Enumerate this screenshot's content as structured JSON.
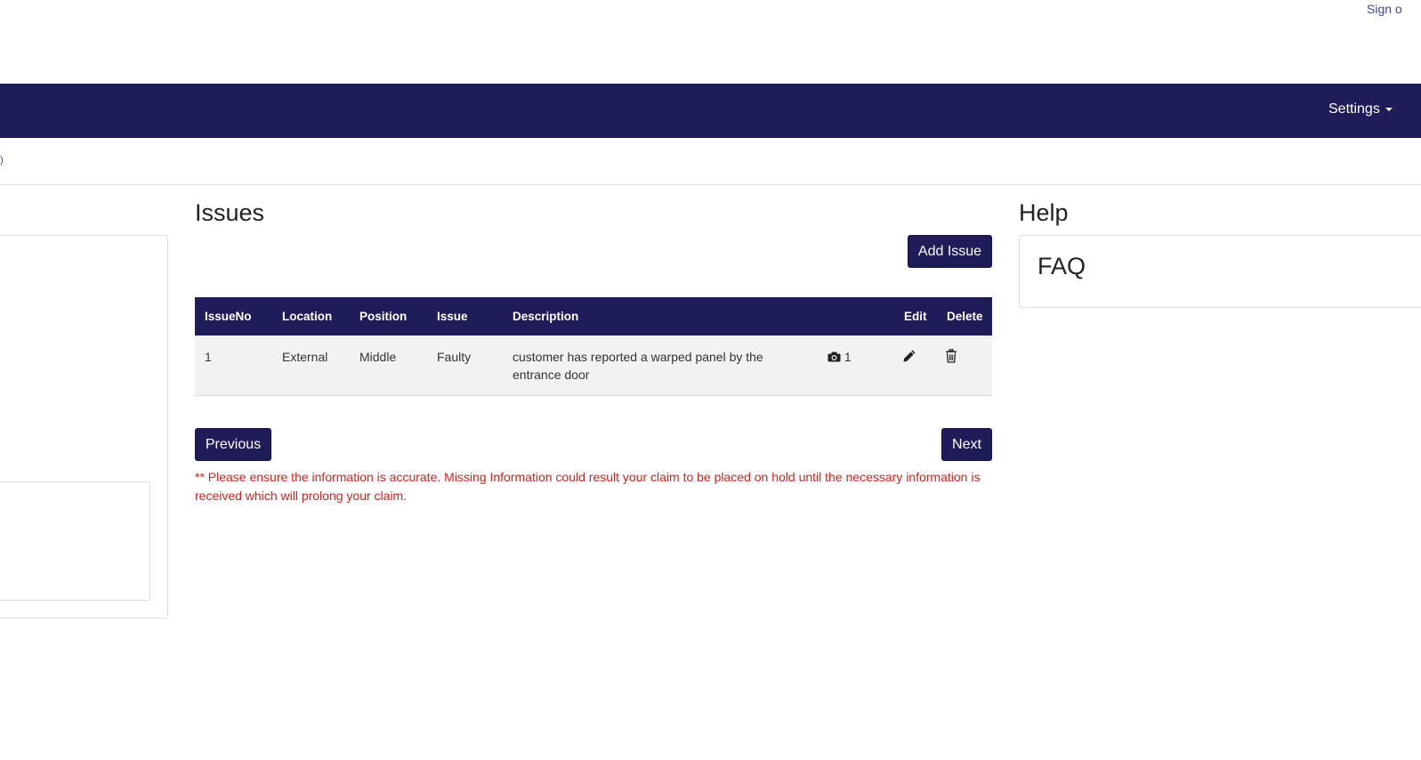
{
  "header": {
    "signin_label": "Sign o"
  },
  "navbar": {
    "settings_label": "Settings"
  },
  "breadcrumb": {
    "text": ")"
  },
  "issues": {
    "title": "Issues",
    "add_button_label": "Add Issue",
    "columns": [
      "IssueNo",
      "Location",
      "Position",
      "Issue",
      "Description",
      "",
      "Edit",
      "Delete"
    ],
    "rows": [
      {
        "issue_no": "1",
        "location": "External",
        "position": "Middle",
        "issue": "Faulty",
        "description": "customer has reported a warped panel by the entrance door",
        "photo_count": "1"
      }
    ],
    "previous_label": "Previous",
    "next_label": "Next",
    "warning": "** Please ensure the information is accurate. Missing Information could result your claim to be placed on hold until the necessary information is received which will prolong your claim."
  },
  "help": {
    "title": "Help",
    "faq_label": "FAQ"
  },
  "colors": {
    "navbar": "#1f1c5a",
    "warning": "#d9201c",
    "link": "#3b4a9a"
  }
}
